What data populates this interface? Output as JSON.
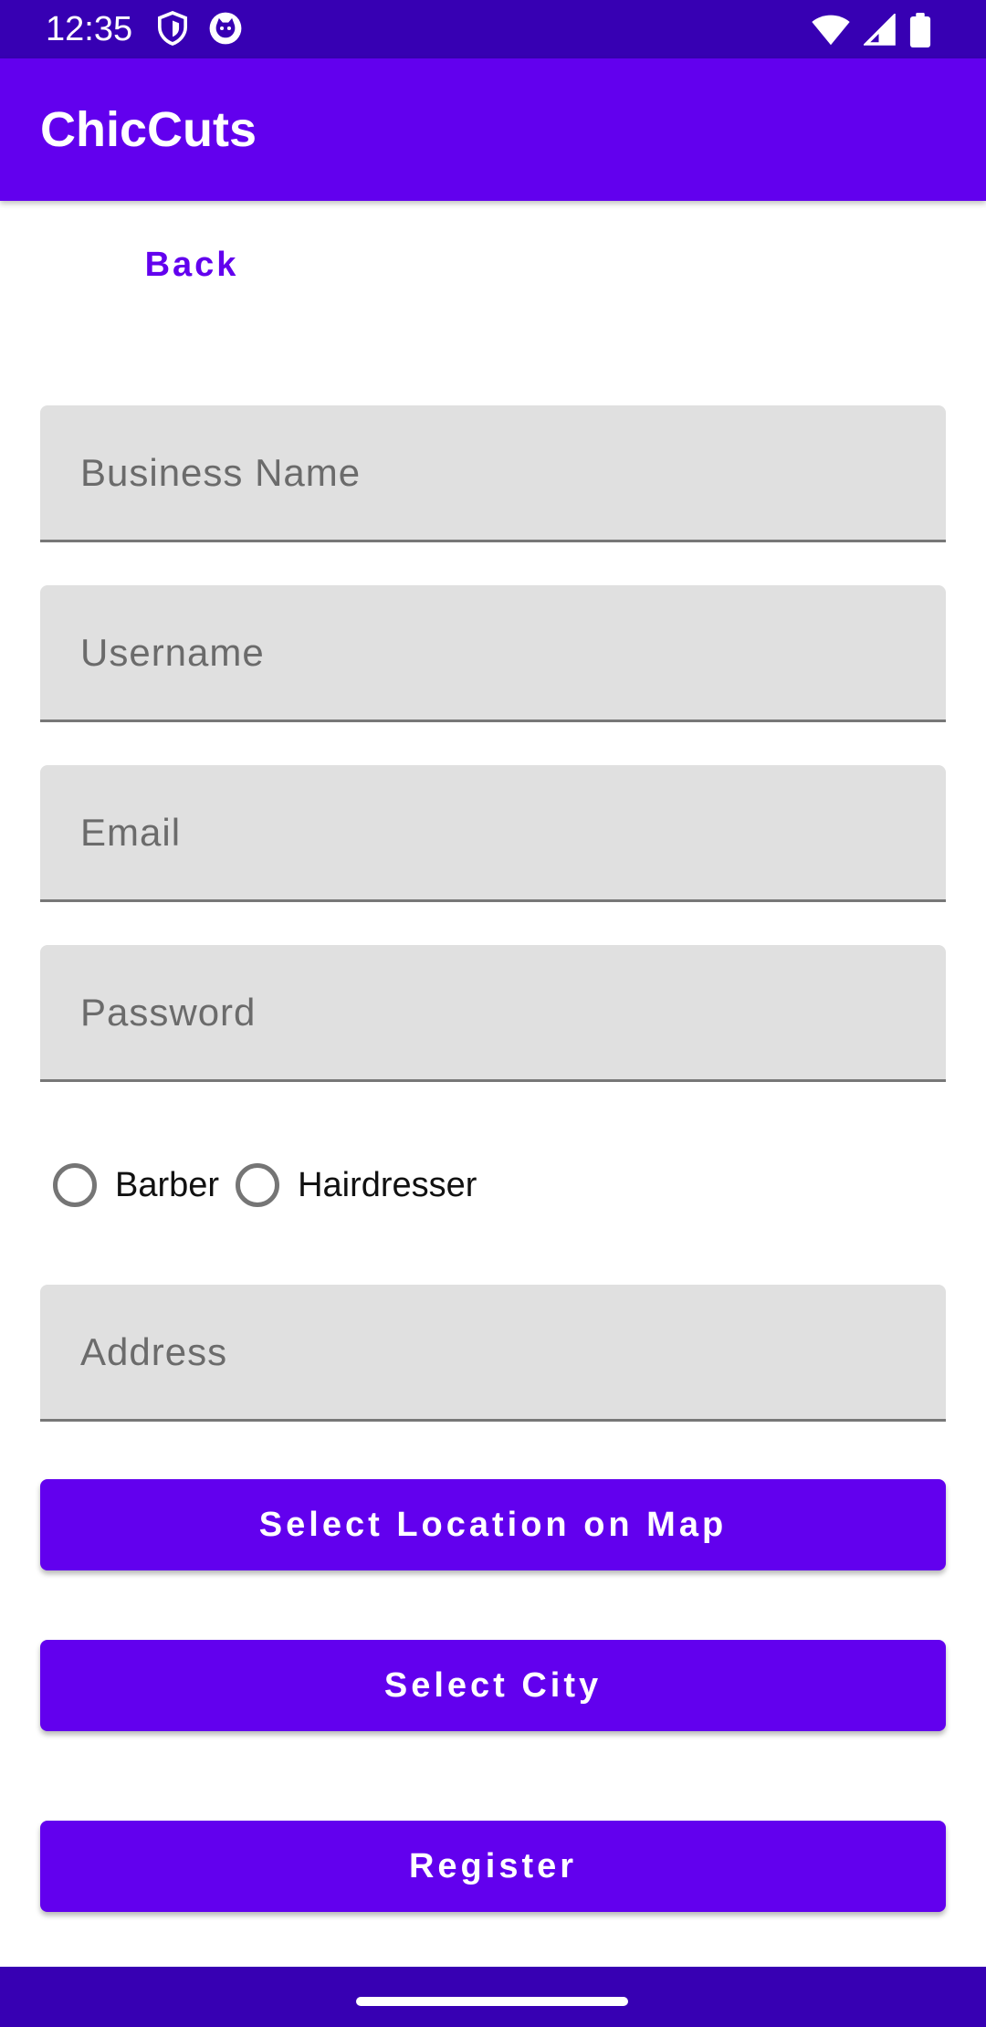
{
  "status_bar": {
    "time": "12:35",
    "left_icons": [
      "shield-icon",
      "cat-face-icon"
    ],
    "right_icons": [
      "wifi-icon",
      "cellular-signal-icon",
      "battery-icon"
    ],
    "background": "#3700b3"
  },
  "app_bar": {
    "title": "ChicCuts",
    "background": "#6200ee"
  },
  "form": {
    "back_label": "Back",
    "business_name_placeholder": "Business Name",
    "username_placeholder": "Username",
    "email_placeholder": "Email",
    "password_placeholder": "Password",
    "role_options": [
      {
        "label": "Barber",
        "selected": false
      },
      {
        "label": "Hairdresser",
        "selected": false
      }
    ],
    "address_placeholder": "Address",
    "select_location_label": "Select Location on Map",
    "select_city_label": "Select City",
    "register_label": "Register"
  },
  "colors": {
    "accent": "#6200ee",
    "accent_dark": "#3700b3",
    "field_background": "#e0e0e0"
  }
}
